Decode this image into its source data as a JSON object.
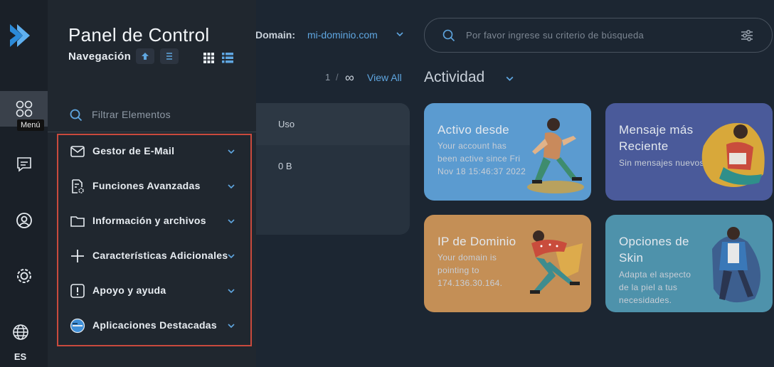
{
  "rail": {
    "tooltip": "Menú",
    "language": "ES",
    "icons": [
      "logo-icon",
      "menu-grid-icon",
      "chat-icon",
      "user-icon",
      "settings-icon",
      "globe-icon"
    ]
  },
  "panel": {
    "title": "Panel de Control",
    "subtitle": "Navegación",
    "filter_placeholder": "Filtrar Elementos",
    "items": [
      {
        "label": "Gestor de E-Mail",
        "icon": "envelope-icon"
      },
      {
        "label": "Funciones Avanzadas",
        "icon": "document-settings-icon"
      },
      {
        "label": "Información y archivos",
        "icon": "folder-icon"
      },
      {
        "label": "Características Adicionales",
        "icon": "plus-icon"
      },
      {
        "label": "Apoyo y ayuda",
        "icon": "alert-icon"
      },
      {
        "label": "Aplicaciones Destacadas",
        "icon": "apps-icon"
      }
    ]
  },
  "header": {
    "domain_label": "Domain:",
    "domain_value": "mi-dominio.com",
    "search_placeholder": "Por favor ingrese su criterio de búsqueda"
  },
  "pagination": {
    "page": "1",
    "separator": "/",
    "infinity": "∞",
    "view_all": "View All"
  },
  "usage": {
    "header": "Uso",
    "value": "0 B"
  },
  "activity": {
    "title": "Actividad",
    "cards": [
      {
        "title": "Activo desde",
        "lines": [
          "Your account has",
          "been active since Fri",
          "Nov 18 15:46:37 2022"
        ],
        "color": "#5b9bd0"
      },
      {
        "title_lines": [
          "Mensaje más",
          "Reciente"
        ],
        "lines": [
          "Sin mensajes nuevos"
        ],
        "color": "#4a5a9a"
      },
      {
        "title": "IP de Dominio",
        "lines": [
          "Your domain is",
          "pointing to",
          "174.136.30.164."
        ],
        "color": "#c48f56"
      },
      {
        "title_lines": [
          "Opciones de",
          "Skin"
        ],
        "lines": [
          "Adapta el aspecto",
          "de la piel a tus",
          "necesidades."
        ],
        "color": "#4e92ab"
      }
    ]
  },
  "colors": {
    "accent": "#5fa6e0",
    "highlight_border": "#c94a3d",
    "panel_bg": "#20272f"
  }
}
